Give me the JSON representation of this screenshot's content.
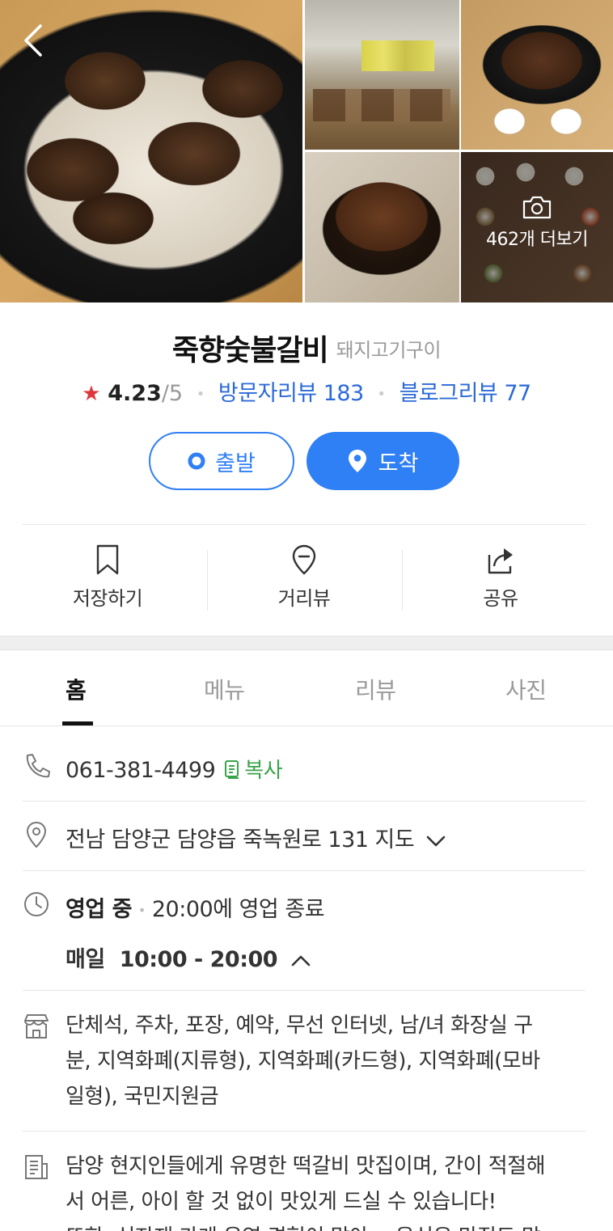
{
  "photos": {
    "more_label": "462개 더보기"
  },
  "place": {
    "name": "죽향숯불갈비",
    "category": "돼지고기구이",
    "rating": "4.23",
    "rating_scale": "/5",
    "visitor_reviews": "방문자리뷰 183",
    "blog_reviews": "블로그리뷰 77"
  },
  "directions": {
    "depart_label": "출발",
    "arrive_label": "도착",
    "accent_color": "#2f7ff5"
  },
  "actions": {
    "save": "저장하기",
    "street_view": "거리뷰",
    "share": "공유"
  },
  "tabs": {
    "home": "홈",
    "menu": "메뉴",
    "review": "리뷰",
    "photo": "사진"
  },
  "info": {
    "phone": "061-381-4499",
    "copy_label": "복사",
    "address": "전남 담양군 담양읍 죽녹원로 131",
    "map_label": "지도",
    "status": "영업 중",
    "closing": "20:00에 영업 종료",
    "hours_day": "매일",
    "hours_time": "10:00 - 20:00",
    "amenities_line1": "단체석, 주차, 포장, 예약, 무선 인터넷, 남/녀 화장실 구",
    "amenities_line2": "분, 지역화폐(지류형), 지역화폐(카드형), 지역화폐(모바",
    "amenities_line3": "일형), 국민지원금",
    "desc_line1": "담양 현지인들에게 유명한 떡갈비 맛집이며, 간이 적절해",
    "desc_line2": "서 어른, 아이 할 것 없이 맛있게 드실 수 있습니다!",
    "desc_line3": "또한, 식자재 가게 운영 경험이 많아… 음식은 맛집도 많"
  }
}
